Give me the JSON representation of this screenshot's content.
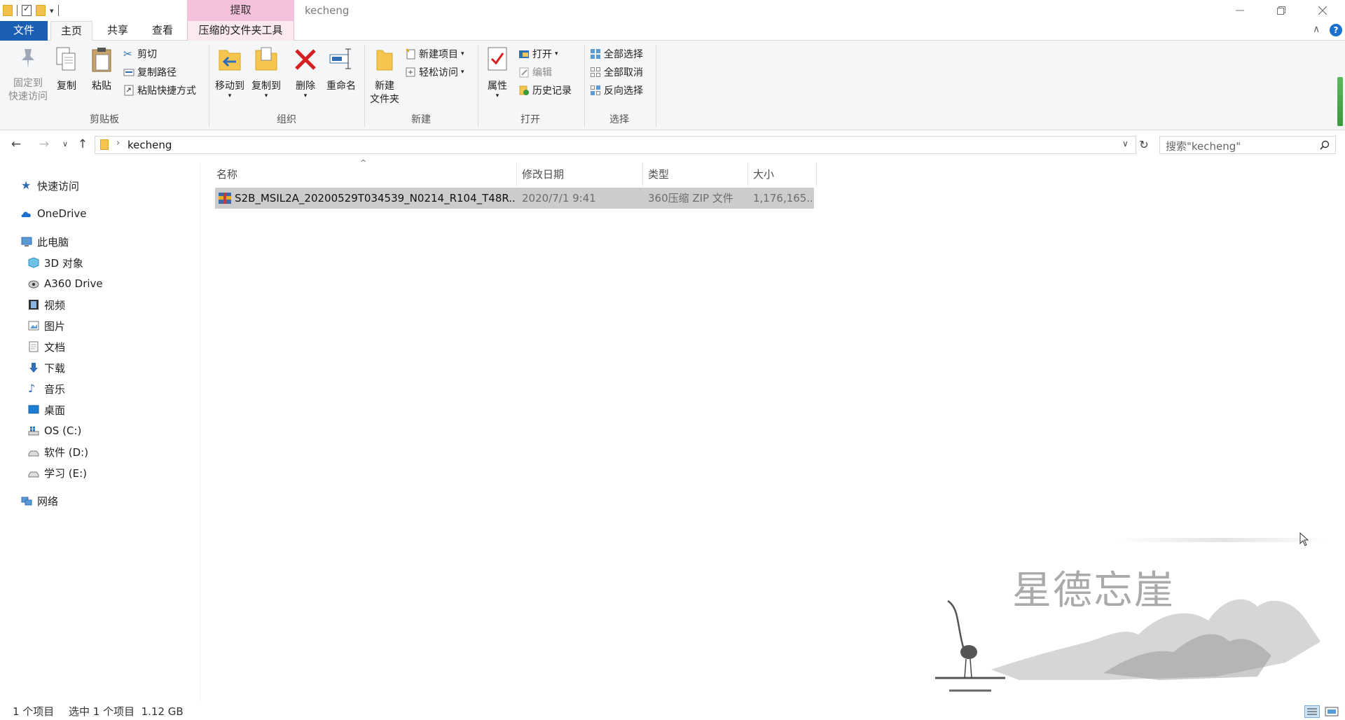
{
  "window": {
    "title": "kecheng",
    "context_tab_group": "提取"
  },
  "tabs": {
    "file": "文件",
    "home": "主页",
    "share": "共享",
    "view": "查看",
    "compressed_tools": "压缩的文件夹工具"
  },
  "ribbon": {
    "clipboard": {
      "label": "剪贴板",
      "pin_line1": "固定到",
      "pin_line2": "快速访问",
      "copy": "复制",
      "paste": "粘贴",
      "cut": "剪切",
      "copy_path": "复制路径",
      "paste_shortcut": "粘贴快捷方式"
    },
    "organize": {
      "label": "组织",
      "move_to": "移动到",
      "copy_to": "复制到",
      "delete": "删除",
      "rename": "重命名"
    },
    "new": {
      "label": "新建",
      "new_folder_line1": "新建",
      "new_folder_line2": "文件夹",
      "new_item": "新建项目",
      "easy_access": "轻松访问"
    },
    "open": {
      "label": "打开",
      "properties": "属性",
      "open": "打开",
      "edit": "编辑",
      "history": "历史记录"
    },
    "select": {
      "label": "选择",
      "select_all": "全部选择",
      "select_none": "全部取消",
      "invert": "反向选择"
    }
  },
  "address": {
    "path": "kecheng",
    "search_placeholder": "搜索\"kecheng\""
  },
  "sidebar": {
    "quick_access": "快速访问",
    "onedrive": "OneDrive",
    "this_pc": "此电脑",
    "items": [
      "3D 对象",
      "A360 Drive",
      "视频",
      "图片",
      "文档",
      "下载",
      "音乐",
      "桌面",
      "OS (C:)",
      "软件 (D:)",
      "学习 (E:)"
    ],
    "network": "网络"
  },
  "columns": {
    "name": "名称",
    "modified": "修改日期",
    "type": "类型",
    "size": "大小"
  },
  "files": [
    {
      "name": "S2B_MSIL2A_20200529T034539_N0214_R104_T48R...",
      "modified": "2020/7/1 9:41",
      "type": "360压缩 ZIP 文件",
      "size": "1,176,165..."
    }
  ],
  "status": {
    "count": "1 个项目",
    "selected": "选中 1 个项目  1.12 GB"
  },
  "watermark": {
    "text": "星德忘崖"
  },
  "colors": {
    "file_tab": "#1a5fb4",
    "context_tab": "#f6c1dc",
    "selection": "#cccccc"
  }
}
